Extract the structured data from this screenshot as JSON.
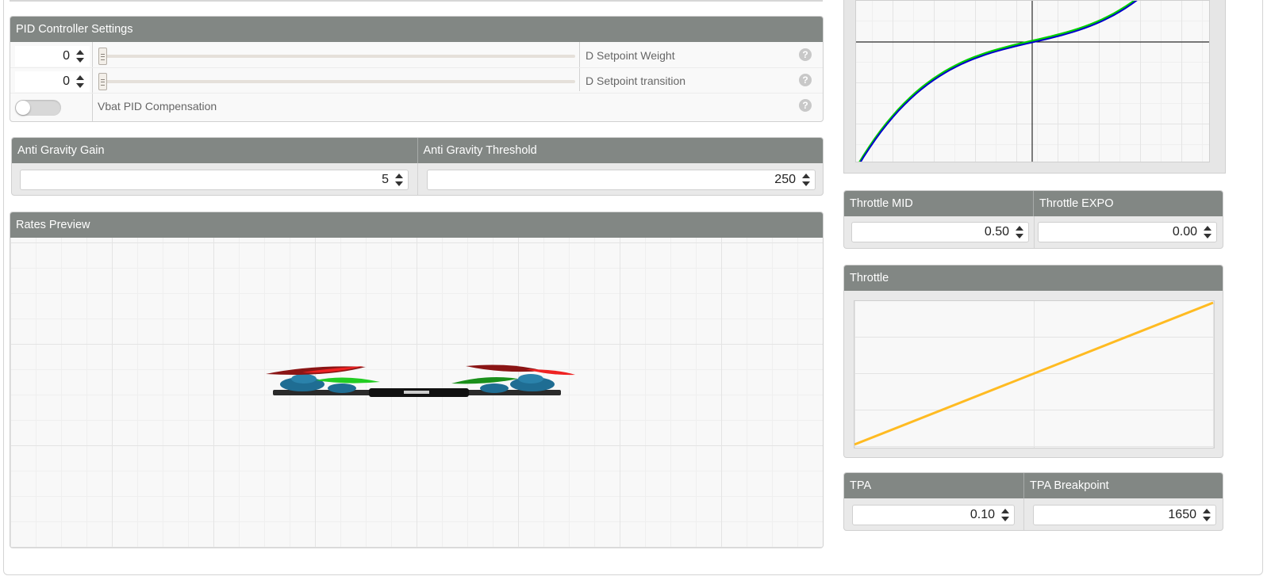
{
  "pid_settings": {
    "title": "PID Controller Settings",
    "d_setpoint_weight": {
      "value": "0",
      "label": "D Setpoint Weight",
      "slider_fraction": 0
    },
    "d_setpoint_transition": {
      "value": "0",
      "label": "D Setpoint transition",
      "slider_fraction": 0
    },
    "vbat_pid_compensation": {
      "label": "Vbat PID Compensation",
      "enabled": false
    },
    "help_glyph": "?"
  },
  "anti_gravity": {
    "gain_title": "Anti Gravity Gain",
    "gain_value": "5",
    "threshold_title": "Anti Gravity Threshold",
    "threshold_value": "250"
  },
  "rates_preview": {
    "title": "Rates Preview",
    "model": "quadcopter-model"
  },
  "rates_curve": {
    "type": "line",
    "series_colors": [
      "#00d000",
      "#0000cc"
    ]
  },
  "throttle_settings": {
    "mid_title": "Throttle MID",
    "mid_value": "0.50",
    "expo_title": "Throttle EXPO",
    "expo_value": "0.00"
  },
  "throttle_curve": {
    "title": "Throttle",
    "type": "line",
    "line_color": "#ffbb22"
  },
  "tpa": {
    "tpa_title": "TPA",
    "tpa_value": "0.10",
    "breakpoint_title": "TPA Breakpoint",
    "breakpoint_value": "1650"
  }
}
